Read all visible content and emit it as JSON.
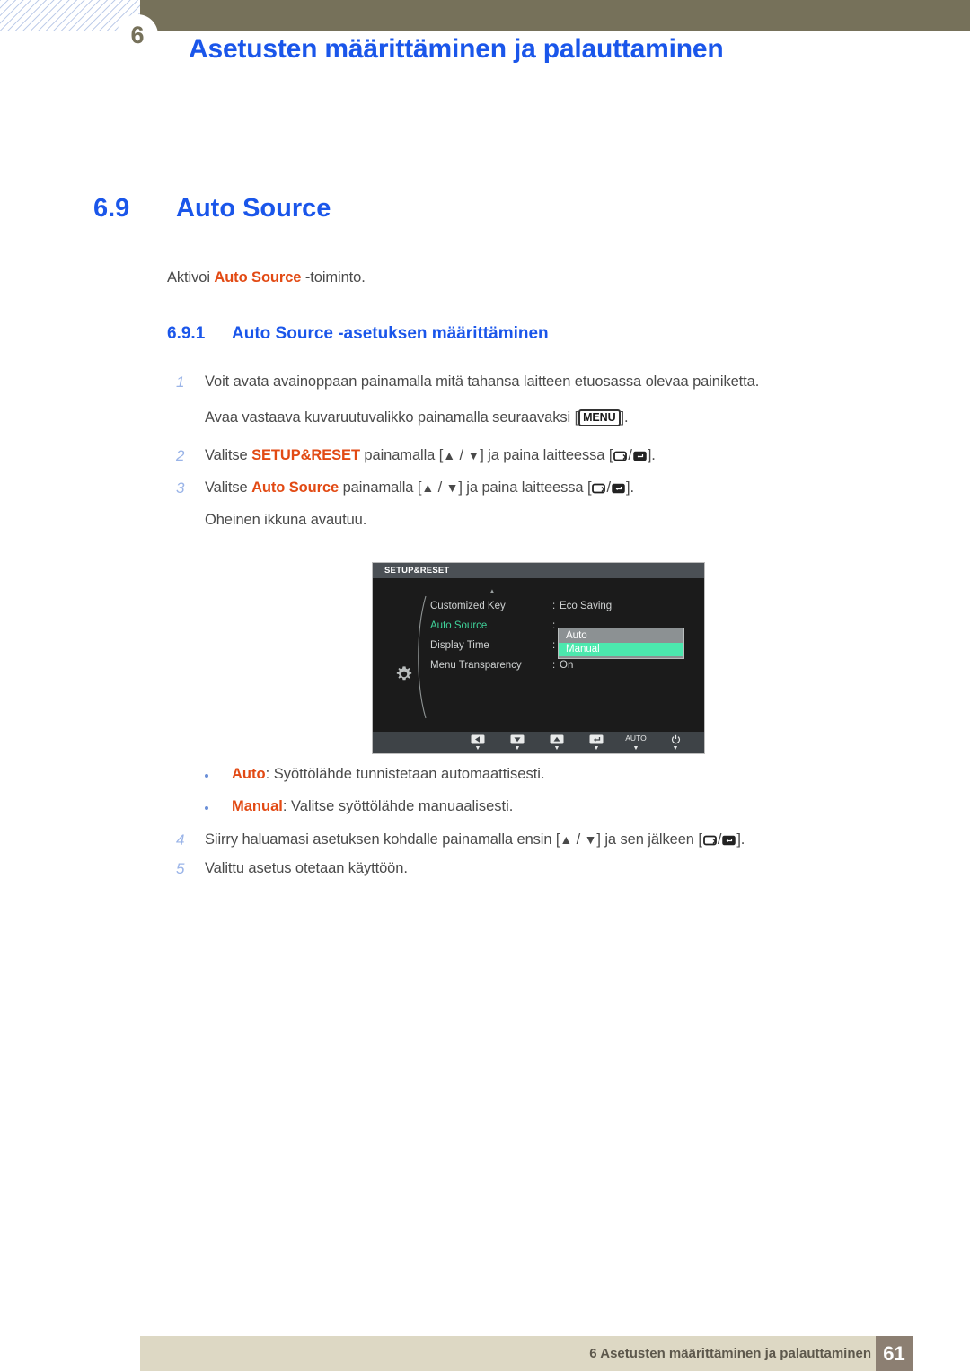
{
  "header": {
    "chapter_number": "6",
    "title": "Asetusten määrittäminen ja palauttaminen",
    "bar_color": "#76715a",
    "title_color": "#1a56ea"
  },
  "section": {
    "number": "6.9",
    "title": "Auto Source"
  },
  "intro": {
    "before": "Aktivoi ",
    "highlight": "Auto Source",
    "after": " -toiminto."
  },
  "subsection": {
    "number": "6.9.1",
    "title": "Auto Source -asetuksen määrittäminen"
  },
  "steps": [
    {
      "num": "1",
      "parts": [
        {
          "type": "text",
          "value": "Voit avata avainoppaan painamalla mitä tahansa laitteen etuosassa olevaa painiketta."
        }
      ]
    },
    {
      "num": "",
      "parts": [
        {
          "type": "text",
          "value": "Avaa vastaava kuvaruutuvalikko painamalla seuraavaksi ["
        },
        {
          "type": "keybox",
          "value": "MENU"
        },
        {
          "type": "text",
          "value": "]."
        }
      ]
    },
    {
      "num": "2",
      "parts": [
        {
          "type": "text",
          "value": "Valitse "
        },
        {
          "type": "hl",
          "value": "SETUP&RESET"
        },
        {
          "type": "text",
          "value": " painamalla ["
        },
        {
          "type": "tri",
          "value": "▲"
        },
        {
          "type": "text",
          "value": " / "
        },
        {
          "type": "tri",
          "value": "▼"
        },
        {
          "type": "text",
          "value": "] ja paina laitteessa ["
        },
        {
          "type": "glyph",
          "value": "return-box-icon"
        },
        {
          "type": "text",
          "value": " / "
        },
        {
          "type": "glyph",
          "value": "enter-box-icon"
        },
        {
          "type": "text",
          "value": "]."
        }
      ]
    },
    {
      "num": "3",
      "parts": [
        {
          "type": "text",
          "value": "Valitse "
        },
        {
          "type": "hl",
          "value": "Auto Source"
        },
        {
          "type": "text",
          "value": " painamalla ["
        },
        {
          "type": "tri",
          "value": "▲"
        },
        {
          "type": "text",
          "value": " / "
        },
        {
          "type": "tri",
          "value": "▼"
        },
        {
          "type": "text",
          "value": "] ja paina laitteessa ["
        },
        {
          "type": "glyph",
          "value": "return-box-icon"
        },
        {
          "type": "text",
          "value": " / "
        },
        {
          "type": "glyph",
          "value": "enter-box-icon"
        },
        {
          "type": "text",
          "value": "]."
        }
      ]
    },
    {
      "num": "",
      "parts": [
        {
          "type": "text",
          "value": "Oheinen ikkuna avautuu."
        }
      ]
    },
    {
      "num": "4",
      "parts": [
        {
          "type": "text",
          "value": "Siirry haluamasi asetuksen kohdalle painamalla ensin ["
        },
        {
          "type": "tri",
          "value": "▲"
        },
        {
          "type": "text",
          "value": " / "
        },
        {
          "type": "tri",
          "value": "▼"
        },
        {
          "type": "text",
          "value": "] ja sen jälkeen ["
        },
        {
          "type": "glyph",
          "value": "return-box-icon"
        },
        {
          "type": "text",
          "value": " / "
        },
        {
          "type": "glyph",
          "value": "enter-box-icon"
        },
        {
          "type": "text",
          "value": "]."
        }
      ]
    },
    {
      "num": "5",
      "parts": [
        {
          "type": "text",
          "value": "Valittu asetus otetaan käyttöön."
        }
      ]
    }
  ],
  "step_text": {
    "s1": "Voit avata avainoppaan painamalla mitä tahansa laitteen etuosassa olevaa painiketta.",
    "s1b_before": "Avaa vastaava kuvaruutuvalikko painamalla seuraavaksi [",
    "s1b_key": "MENU",
    "s1b_after": "].",
    "s2_before": "Valitse ",
    "s2_hl": "SETUP&RESET",
    "s2_mid": " painamalla [",
    "s2_mid2": "] ja paina laitteessa [",
    "s2_after": "].",
    "s3_before": "Valitse ",
    "s3_hl": "Auto Source",
    "s3_mid": " painamalla [",
    "s3_mid2": "] ja paina laitteessa [",
    "s3_after": "].",
    "s3b": "Oheinen ikkuna avautuu.",
    "s4_before": "Siirry haluamasi asetuksen kohdalle painamalla ensin [",
    "s4_mid": "] ja sen jälkeen [",
    "s4_after": "].",
    "s5": "Valittu asetus otetaan käyttöön."
  },
  "step_numbers": {
    "n1": "1",
    "n2": "2",
    "n3": "3",
    "n4": "4",
    "n5": "5"
  },
  "bullets": [
    {
      "term": "Auto",
      "desc": ": Syöttölähde tunnistetaan automaattisesti."
    },
    {
      "term": "Manual",
      "desc": ": Valitse syöttölähde manuaalisesti."
    }
  ],
  "osd": {
    "title": "SETUP&RESET",
    "menu_items": [
      {
        "label": "Customized Key",
        "colon": ":",
        "value": "Eco Saving",
        "active": false
      },
      {
        "label": "Auto Source",
        "colon": ":",
        "value": "",
        "active": true
      },
      {
        "label": "Display Time",
        "colon": ":",
        "value": "",
        "active": false
      },
      {
        "label": "Menu Transparency",
        "colon": ":",
        "value": "On",
        "active": false
      }
    ],
    "dropdown": {
      "options": [
        "Auto",
        "Manual"
      ],
      "selected": "Manual",
      "option_bg": "#8c9193",
      "selected_bg": "#4ce8ae"
    },
    "toolbar": [
      {
        "label": "",
        "glyph": "◀",
        "name": "left-arrow"
      },
      {
        "label": "",
        "glyph": "▼",
        "name": "down-arrow"
      },
      {
        "label": "",
        "glyph": "▲",
        "name": "up-arrow"
      },
      {
        "label": "",
        "glyph": "↵",
        "name": "enter"
      },
      {
        "label": "AUTO",
        "glyph": "",
        "name": "auto"
      },
      {
        "label": "",
        "glyph": "⏻",
        "name": "power"
      }
    ],
    "active_color": "#3fd39a"
  },
  "footer": {
    "text": "6 Asetusten määrittäminen ja palauttaminen",
    "page_number": "61",
    "bar_color": "#ddd8c4",
    "page_box_color": "#8c7f72"
  }
}
